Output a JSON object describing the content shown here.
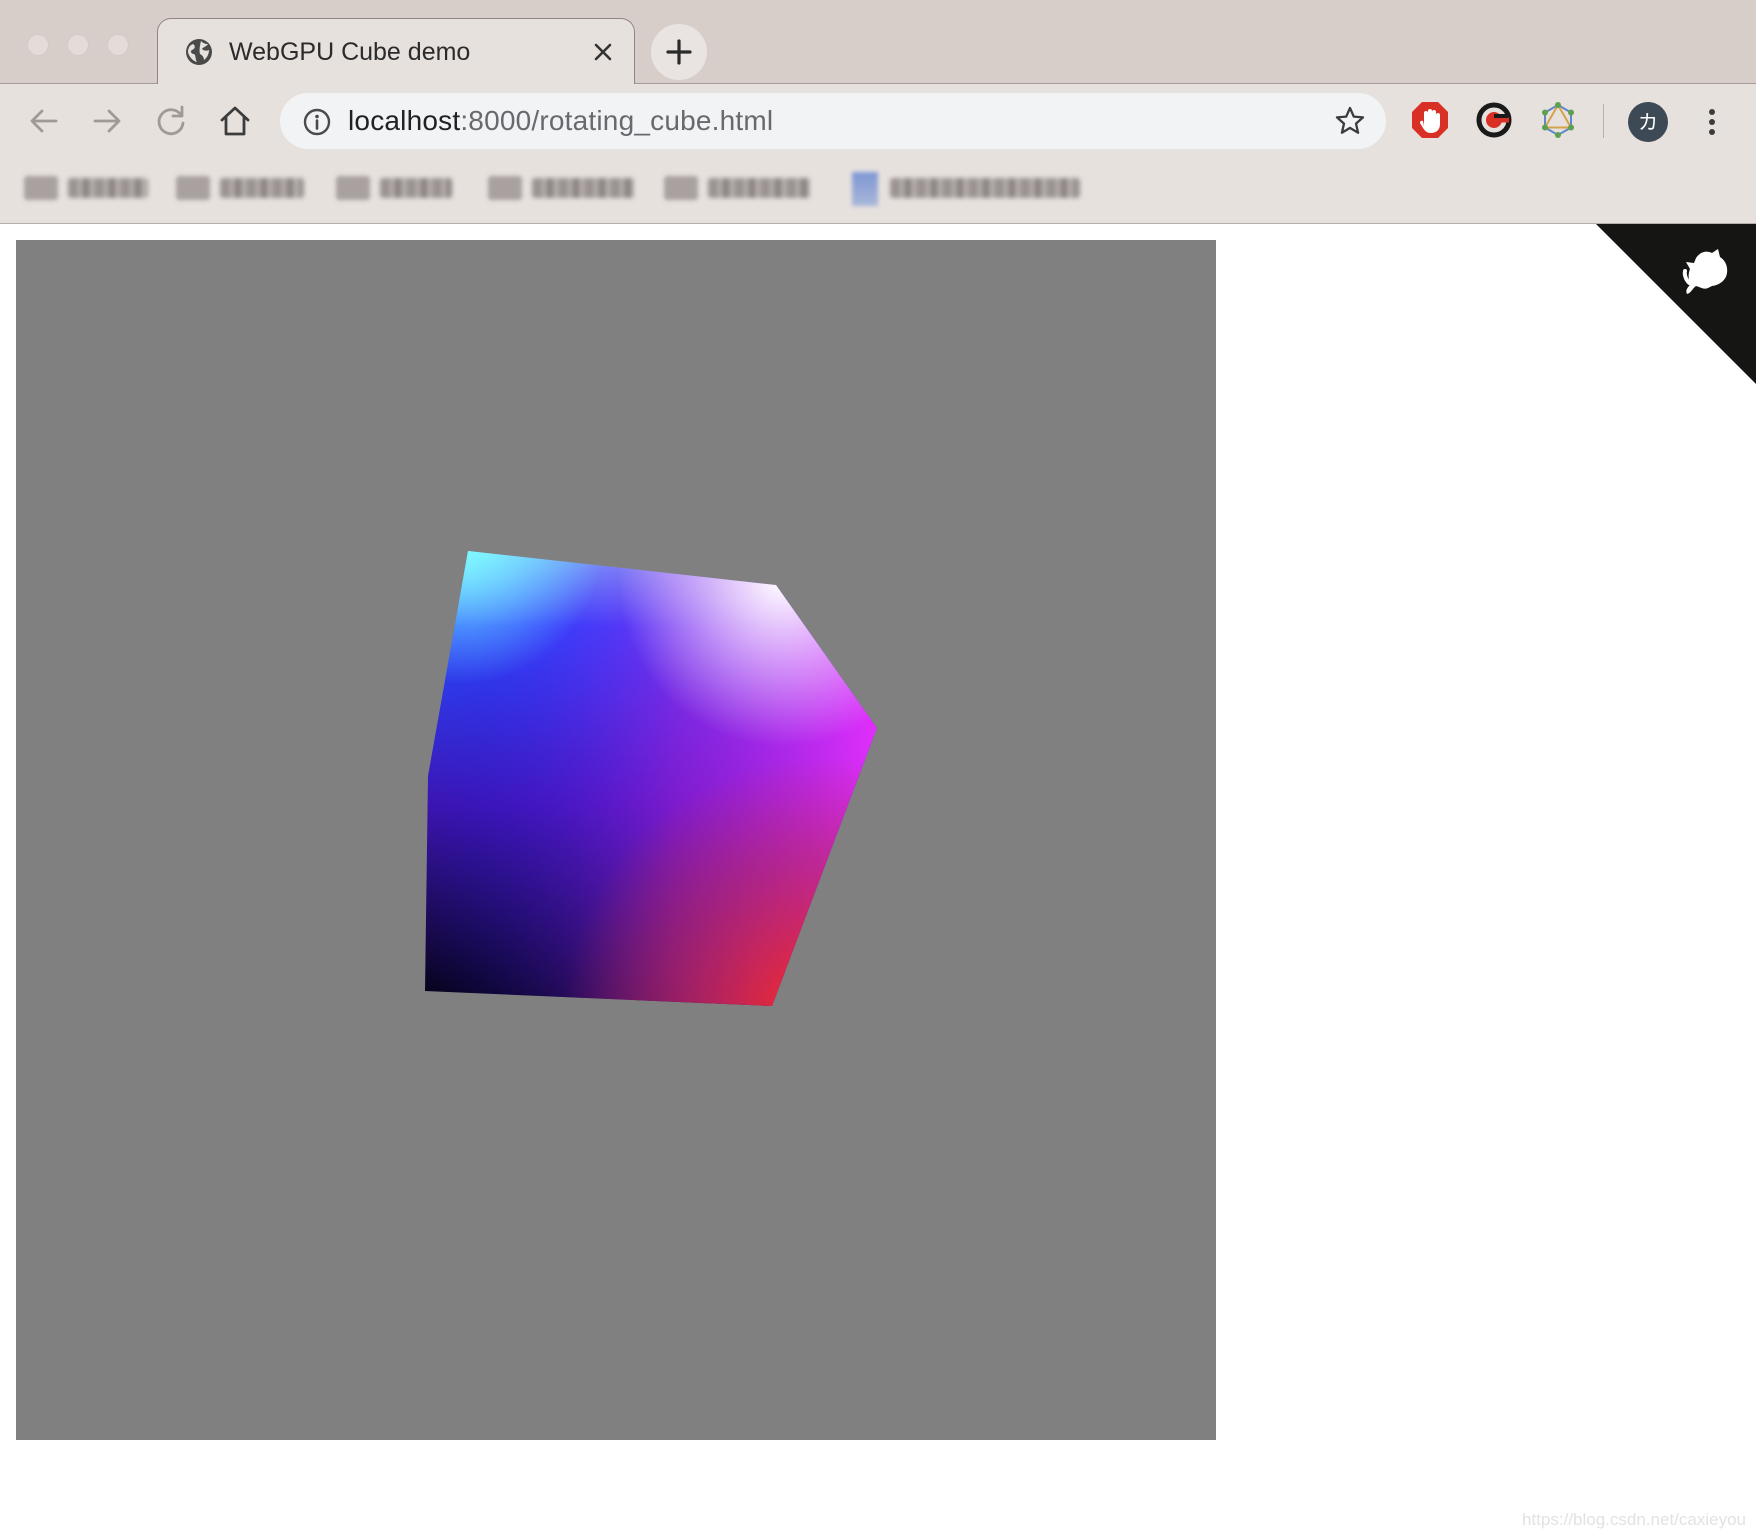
{
  "browser": {
    "tab": {
      "title": "WebGPU Cube demo",
      "favicon": "globe-icon",
      "close_icon": "close-icon"
    },
    "new_tab_icon": "plus-icon",
    "toolbar": {
      "back_icon": "arrow-left-icon",
      "forward_icon": "arrow-right-icon",
      "reload_icon": "reload-icon",
      "home_icon": "home-icon",
      "info_icon": "info-icon",
      "bookmark_star_icon": "star-icon",
      "url_host": "localhost",
      "url_path": ":8000/rotating_cube.html",
      "extensions": [
        "adblock-hand-icon",
        "extension-g-icon",
        "graphql-icon"
      ],
      "profile_initial": "カ",
      "menu_icon": "kebab-menu-icon"
    },
    "bookmarks_blurred": 6
  },
  "page": {
    "canvas_background": "#808080",
    "corner_icon": "github-octocat-icon",
    "watermark": "https://blog.csdn.net/caxieyou"
  },
  "colors": {
    "tab_strip": "#d7ceca",
    "toolbar": "#e7e1de",
    "omnibox": "#f2f3f4",
    "cube_corners": [
      "#000000",
      "#0000ff",
      "#00ffff",
      "#ffffff",
      "#ff00ff",
      "#ff0000"
    ]
  }
}
